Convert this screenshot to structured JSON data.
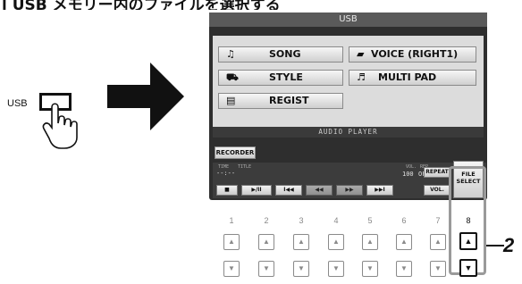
{
  "page_heading": "] USB メモリー内のファイルを選択する",
  "usb_label": "USB",
  "screen": {
    "title": "USB",
    "menu": {
      "song": {
        "label": "SONG",
        "icon": "music-note-icon"
      },
      "voice": {
        "label": "VOICE (RIGHT1)",
        "icon": "piano-icon"
      },
      "style": {
        "label": "STYLE",
        "icon": "style-icon"
      },
      "multipad": {
        "label": "MULTI PAD",
        "icon": "multipad-icon"
      },
      "regist": {
        "label": "REGIST",
        "icon": "registration-icon"
      }
    },
    "audio_player_title": "AUDIO PLAYER",
    "recorder_button": "RECORDER",
    "time_label": "TIME",
    "title_label": "TITLE",
    "time_value": "--:--",
    "vol_label": "VOL.",
    "rep_label": "REP.",
    "vol_value": "100",
    "rep_value": "OFF",
    "transport": {
      "stop": "■",
      "play_pause": "▶/II",
      "prev": "I◀◀",
      "rew": "◀◀",
      "ff": "▶▶",
      "next": "▶▶I"
    },
    "repeat_button": "REPEAT",
    "vol_button": "VOL.",
    "file_select": {
      "line1": "FILE",
      "line2": "SELECT"
    }
  },
  "button_numbers": [
    "1",
    "2",
    "3",
    "4",
    "5",
    "6",
    "7",
    "8"
  ],
  "step_marker": "2"
}
